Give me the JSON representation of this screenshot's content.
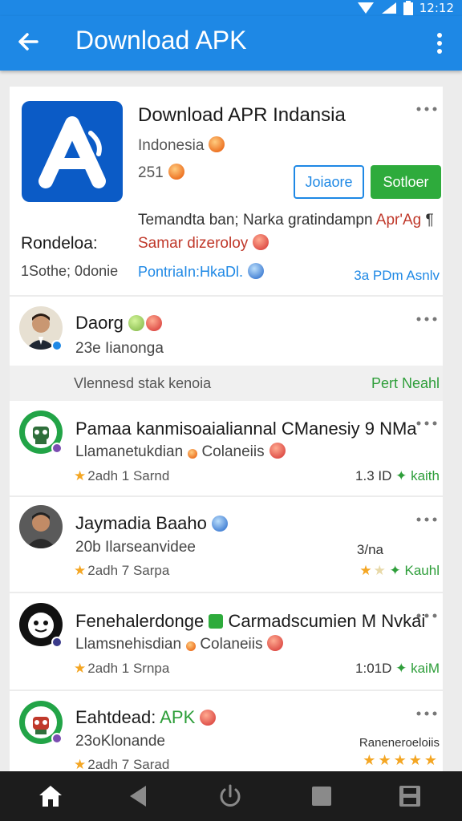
{
  "status": {
    "time": "12:12"
  },
  "appbar": {
    "title": "Download APK"
  },
  "header": {
    "title": "Download APR Indansia",
    "subtitle": "Indonesia",
    "count": "251",
    "btn_outline": "Joiaore",
    "btn_solid": "Sotloer",
    "desc_main": "Temandta ban; Narka gratindampn ",
    "desc_accent": "Apr'Ag",
    "desc_tail": "¶",
    "label": "Rondeloa:",
    "red_text": "Samar dizeroloy",
    "meta": "1Sothe; 0donie",
    "link": "PontriaIn:HkaDl.",
    "right": "3a PDm Asnlv"
  },
  "posts": [
    {
      "name": "Daorg",
      "sub": "23e Iianonga",
      "meta": "",
      "right": ""
    },
    {
      "name": "Pamaa kanmisoaialiannal CManesiy 9 NMa",
      "sub": "Llamanetukdian",
      "sub2": "Colaneiis",
      "meta": "2adh 1 Sarnd",
      "right_num": "1.3 ID",
      "right_green": "kaith"
    },
    {
      "name": "Jaymadia Baaho",
      "sub": "20b Ilarseanvidee",
      "meta": "2adh 7 Sarpa",
      "right_label": "3/na",
      "right_green": "Kauhl"
    },
    {
      "name": "Fenehalerdonge",
      "name2": "Carmadscumien M Nvkai",
      "sub": "Llamsnehisdian",
      "sub2": "Colaneiis",
      "meta": "2adh 1 Srnpa",
      "right_num": "1:01D",
      "right_green": "kaiM"
    },
    {
      "name": "Eahtdead:",
      "name_green": "APK",
      "sub": "23oKlonande",
      "meta": "2adh 7 Sarad",
      "right_label": "Raneneroeloiis"
    }
  ],
  "separator": {
    "text": "Vlennesd stak kenoia",
    "link": "Pert Neahl"
  },
  "colors": {
    "primary": "#1e88e5",
    "green": "#2eab3c",
    "accent_red": "#c0392b",
    "navbar": "#1c1c1c"
  },
  "icons": [
    "back-arrow-icon",
    "more-vertical-icon",
    "wifi-icon",
    "signal-icon",
    "battery-icon",
    "home-icon",
    "back-icon",
    "power-icon",
    "square-icon",
    "save-icon",
    "verified-badge-icon"
  ]
}
